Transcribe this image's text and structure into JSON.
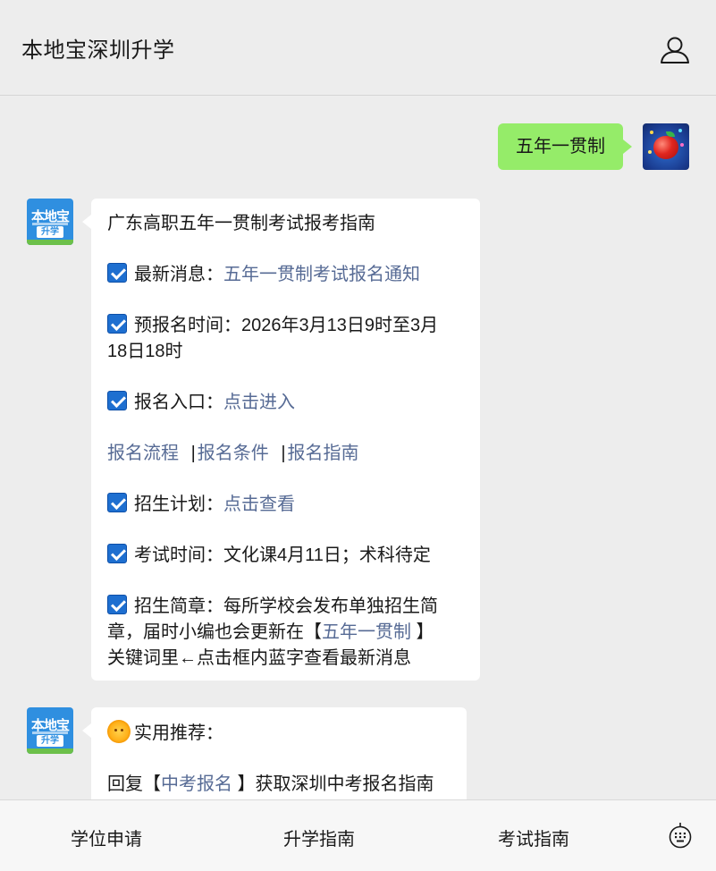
{
  "header": {
    "title": "本地宝深圳升学",
    "user_icon": "user-icon"
  },
  "messages": {
    "user_message": "五年一贯制",
    "bot_avatar": {
      "top": "本地宝",
      "tag": "升学"
    },
    "guide": {
      "title": "广东高职五年一贯制考试报考指南",
      "news_label": "最新消息：",
      "news_link": "五年一贯制考试报名通知",
      "prereg_line1": "预报名时间：2026年3月13日9时至3月",
      "prereg_line2": "18日18时",
      "entry_label": "报名入口：",
      "entry_link": "点击进入",
      "links": [
        "报名流程",
        "报名条件",
        "报名指南"
      ],
      "separator": "|",
      "plan_label": "招生计划：",
      "plan_link": "点击查看",
      "exam_time": "考试时间：文化课4月11日；术科待定",
      "brochure_line1": "招生简章：每所学校会发布单独招生简",
      "brochure_line2_pre": "章，届时小编也会更新在【",
      "brochure_keyword": "五年一贯制",
      "brochure_line2_post": " 】",
      "brochure_line3": "关键词里←点击框内蓝字查看最新消息"
    },
    "recommend": {
      "title": "实用推荐：",
      "reply_pre": "回复【",
      "reply_keyword": "中考报名",
      "reply_post": " 】获取深圳中考报名指南"
    }
  },
  "tabbar": {
    "items": [
      "学位申请",
      "升学指南",
      "考试指南"
    ],
    "keyboard_icon": "keyboard-icon"
  },
  "colors": {
    "background": "#ededed",
    "green_bubble": "#95ec69",
    "link": "#576b95",
    "check": "#1e6fd0"
  }
}
